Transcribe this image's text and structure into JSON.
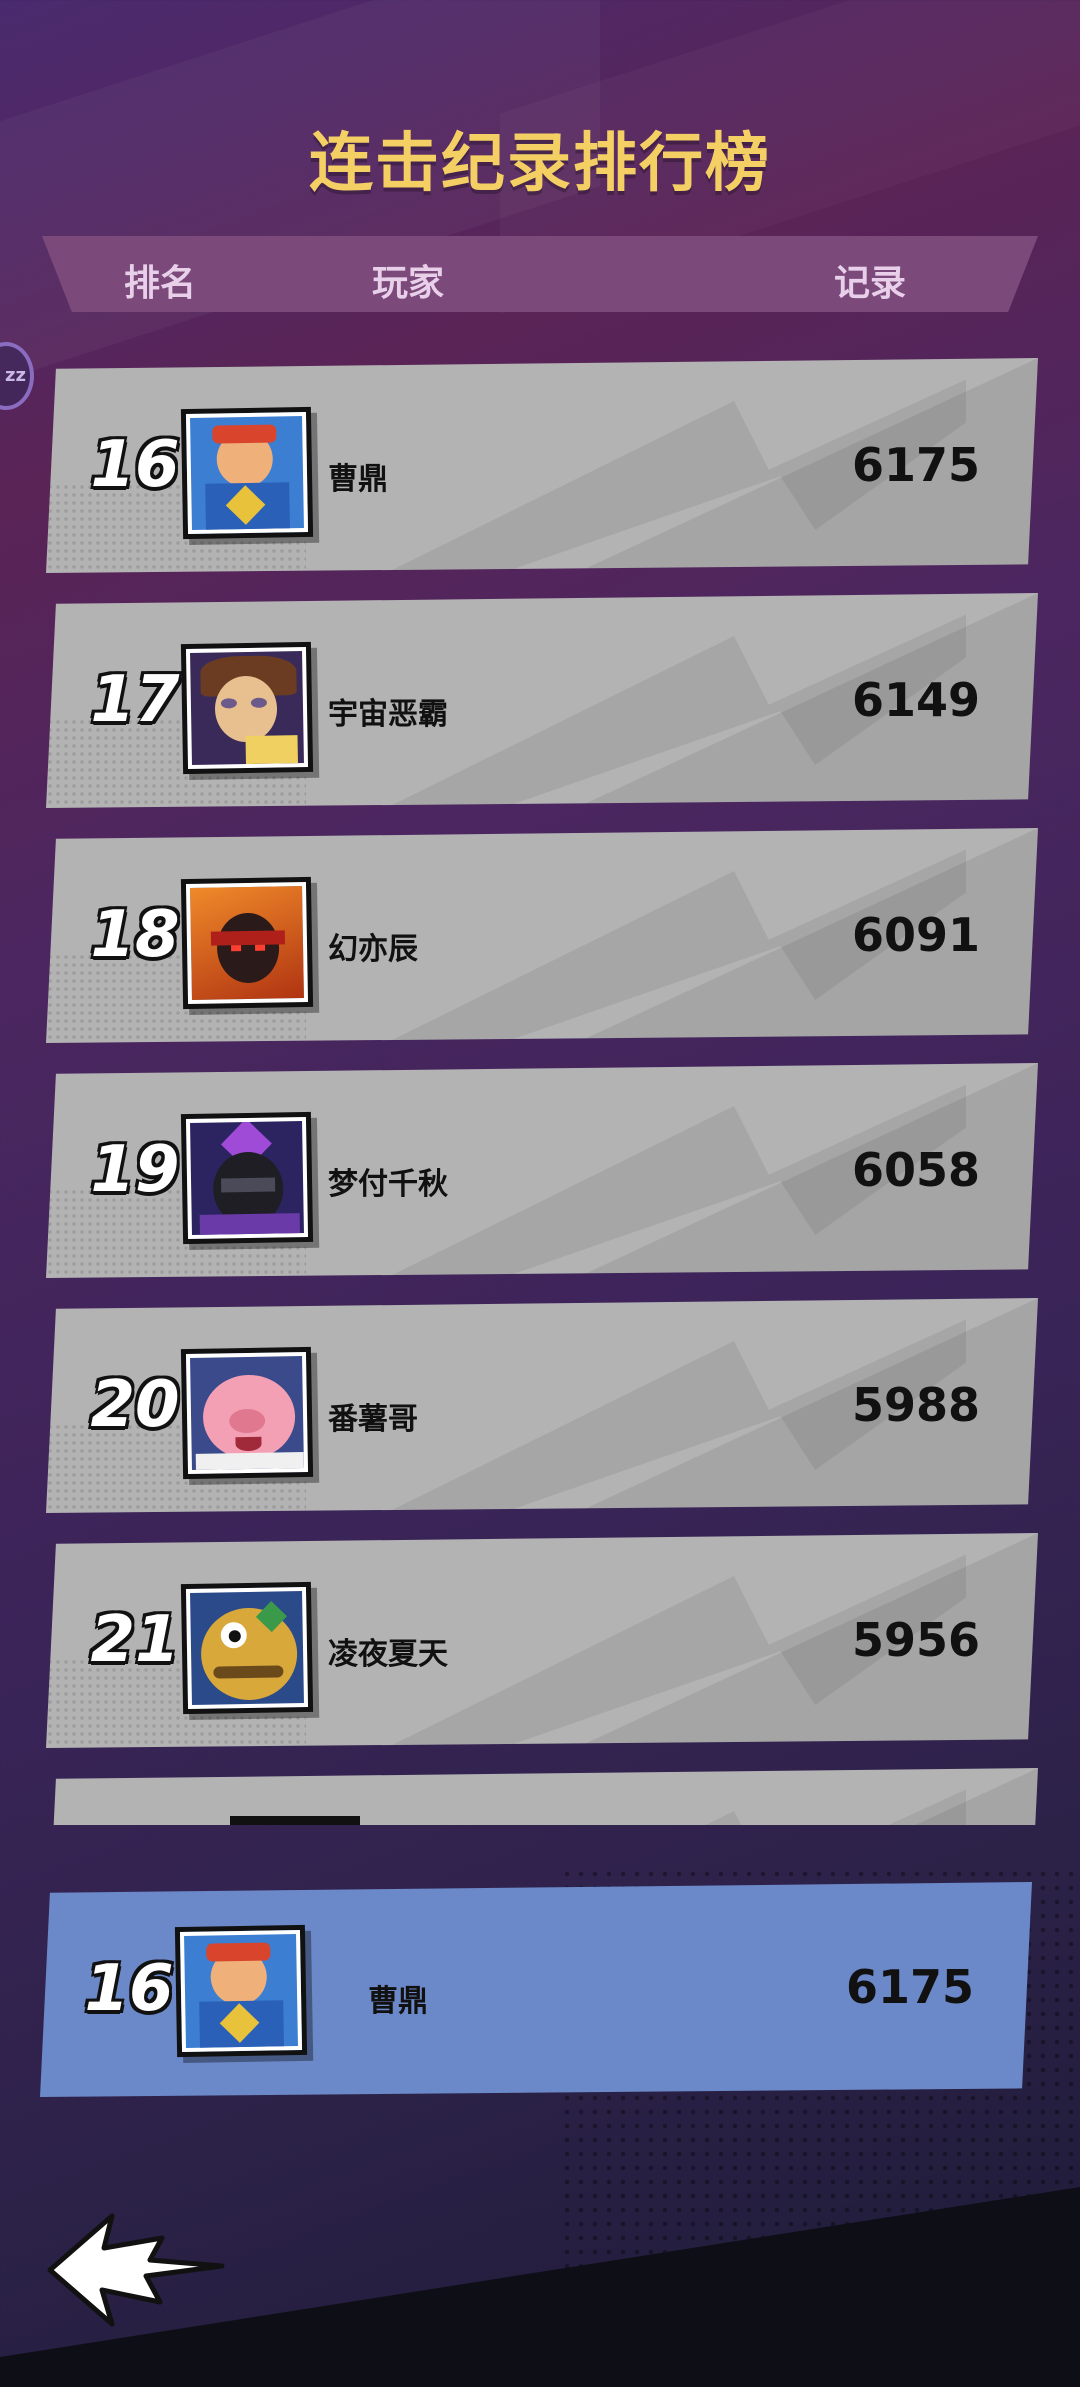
{
  "title": "连击纪录排行榜",
  "header": {
    "rank_label": "排名",
    "player_label": "玩家",
    "record_label": "记录"
  },
  "side_bubble": {
    "text": "zz"
  },
  "rows": [
    {
      "rank": "16",
      "name": "曹鼎",
      "score": "6175",
      "avatar": "hero-red-cap-icon",
      "avatar_color": "#2b6cc2"
    },
    {
      "rank": "17",
      "name": "宇宙恶霸",
      "score": "6149",
      "avatar": "tired-guy-icon",
      "avatar_color": "#3a2a5a"
    },
    {
      "rank": "18",
      "name": "幻亦辰",
      "score": "6091",
      "avatar": "masked-flame-icon",
      "avatar_color": "#c24a1a"
    },
    {
      "rank": "19",
      "name": "梦付千秋",
      "score": "6058",
      "avatar": "purple-helmet-icon",
      "avatar_color": "#2c2460"
    },
    {
      "rank": "20",
      "name": "番薯哥",
      "score": "5988",
      "avatar": "pink-pig-icon",
      "avatar_color": "#3a4a8a"
    },
    {
      "rank": "21",
      "name": "凌夜夏天",
      "score": "5956",
      "avatar": "yellow-monster-icon",
      "avatar_color": "#2a4a8a"
    }
  ],
  "self_row": {
    "rank": "16",
    "name": "曹鼎",
    "score": "6175",
    "avatar": "hero-red-cap-icon"
  },
  "colors": {
    "title": "#f4cf64",
    "row_bg": "#b3b3b3",
    "self_row_bg": "#6b88c8",
    "header_bg": "#7b4a7a"
  },
  "back_button": {
    "icon": "back-arrow-icon"
  }
}
